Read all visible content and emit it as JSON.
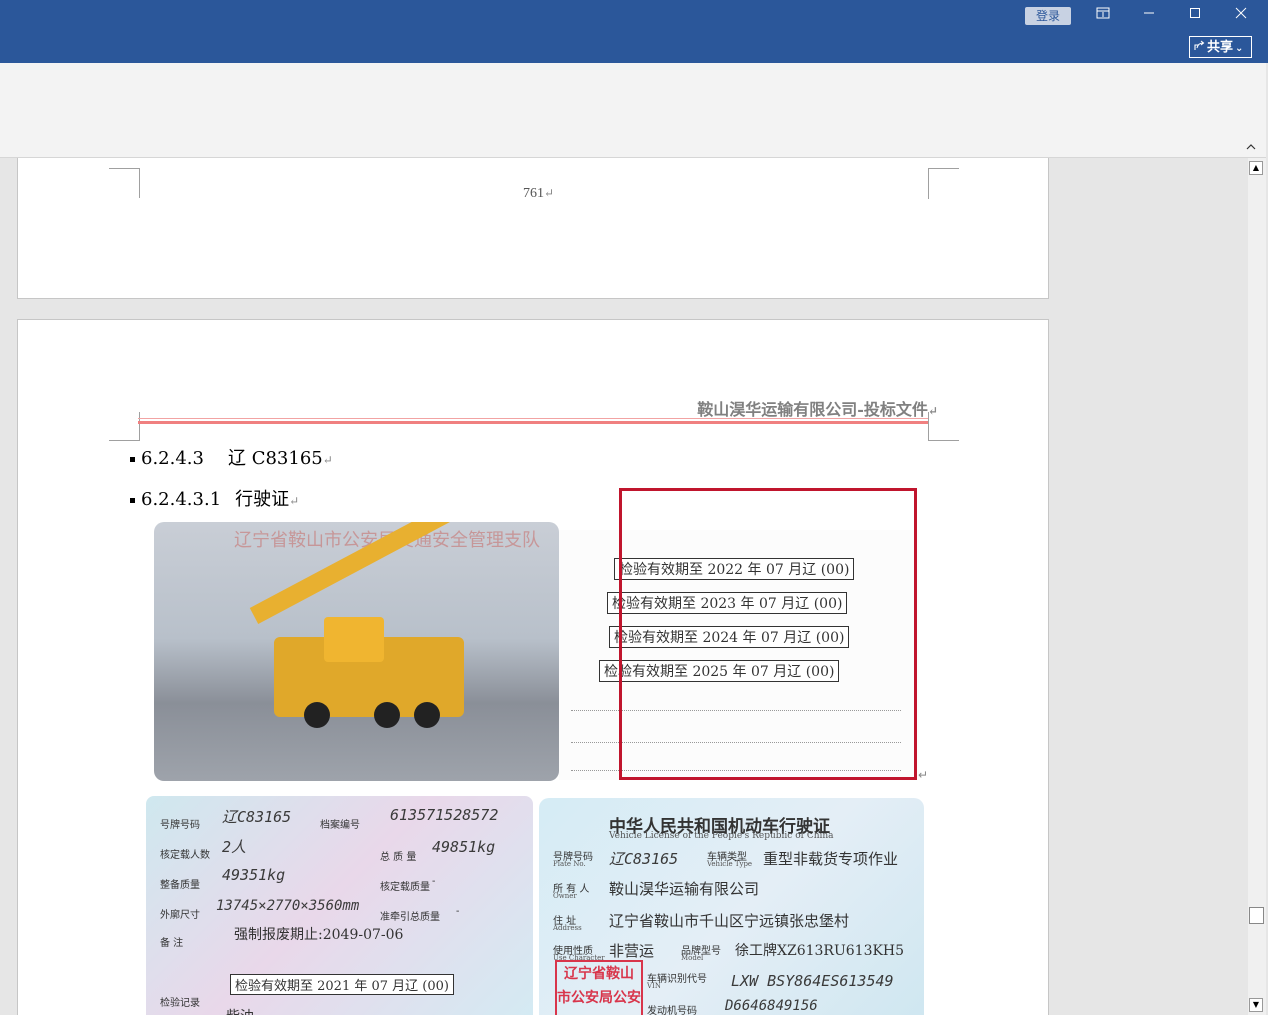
{
  "titlebar": {
    "login_label": "登录",
    "share_label": "共享",
    "share_icon": "share-icon",
    "ribbon_display_icon": "ribbon-display-icon",
    "minimize_icon": "minimize-icon",
    "maximize_icon": "maximize-icon",
    "close_icon": "close-icon",
    "accent": "#2b579a"
  },
  "page1": {
    "page_number": "761"
  },
  "page2": {
    "header": "鞍山淏华运输有限公司-投标文件",
    "heading1_num": "6.2.4.3",
    "heading1_text": "辽 C83165",
    "heading2_num": "6.2.4.3.1",
    "heading2_text": "行驶证",
    "photo_stamp": "辽宁省鞍山市公安局交通安全管理支队",
    "stamps": [
      "检验有效期至 2022 年 07 月辽 (00)",
      "检验有效期至 2023 年 07 月辽 (00)",
      "检验有效期至 2024 年 07 月辽 (00)",
      "检验有效期至 2025 年 07 月辽 (00)"
    ],
    "license_left": {
      "plate_label": "号牌号码",
      "plate": "辽C83165",
      "file_label": "档案编号",
      "file_no": "613571528572",
      "seats_label": "核定载人数",
      "seats": "2人",
      "total_mass_label": "总 质 量",
      "total_mass": "49851kg",
      "curb_label": "整备质量",
      "curb": "49351kg",
      "load_label": "核定载质量",
      "load": "-",
      "dims_label": "外廓尺寸",
      "dims": "13745×2770×3560mm",
      "tow_label": "准牵引总质量",
      "tow": "-",
      "remark_label": "备 注",
      "remark": "强制报废期止:2049-07-06",
      "inspect_label": "检验记录",
      "inspect": "检验有效期至 2021 年 07 月辽 (00)",
      "fuel": "柴油"
    },
    "license_right": {
      "title": "中华人民共和国机动车行驶证",
      "title_en": "Vehicle License of the People's Republic of China",
      "plate_label": "号牌号码",
      "plate_label_en": "Plate No.",
      "plate": "辽C83165",
      "type_label": "车辆类型",
      "type_label_en": "Vehicle Type",
      "type": "重型非载货专项作业",
      "owner_label": "所 有 人",
      "owner_label_en": "Owner",
      "owner": "鞍山淏华运输有限公司",
      "address_label": "住 址",
      "address_label_en": "Address",
      "address": "辽宁省鞍山市千山区宁远镇张忠堡村",
      "use_label": "使用性质",
      "use_label_en": "Use Character",
      "use": "非营运",
      "model_label": "品牌型号",
      "model_label_en": "Model",
      "model": "徐工牌XZ613RU613KH5",
      "vin_label": "车辆识别代号",
      "vin_label_en": "VIN",
      "vin": "LXW BSY864ES613549",
      "engine_label": "发动机号码",
      "engine": "D6646849156",
      "seal": "辽宁省鞍山 市公安局公安"
    }
  },
  "scrollbar": {
    "up_icon": "scroll-up-icon",
    "down_icon": "scroll-down-icon",
    "collapse_icon": "collapse-ribbon-icon"
  }
}
